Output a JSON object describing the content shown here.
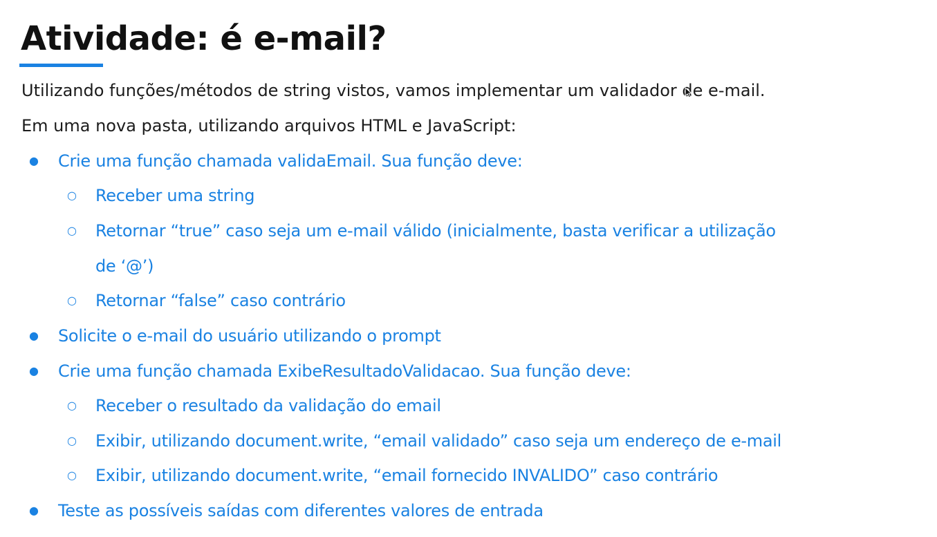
{
  "slide": {
    "title": "Atividade: é e-mail?",
    "intro": [
      "Utilizando funções/métodos de string vistos, vamos implementar um validador de e-mail.",
      "Em uma nova pasta, utilizando arquivos HTML e JavaScript:"
    ],
    "items": [
      "Crie uma função chamada validaEmail. Sua função deve:",
      "Receber uma string",
      "Retornar “true” caso seja um e-mail válido (inicialmente, basta verificar a utilização",
      "de ‘@’)",
      "Retornar “false” caso contrário",
      "Solicite o e-mail do usuário utilizando o prompt",
      "Crie uma função chamada ExibeResultadoValidacao. Sua função deve:",
      "Receber o resultado da validação do email",
      "Exibir, utilizando document.write, “email validado” caso seja um endereço de e-mail",
      "Exibir, utilizando document.write, “email fornecido INVALIDO” caso contrário",
      "Teste as possíveis saídas com diferentes valores de entrada"
    ]
  },
  "colors": {
    "accent": "#1a82e2",
    "text": "#1c1c1c",
    "title": "#111111"
  },
  "icons": {
    "bullet_level1": "filled-circle-bullet-icon",
    "bullet_level2": "hollow-circle-bullet-icon",
    "cursor": "mouse-pointer-icon"
  }
}
